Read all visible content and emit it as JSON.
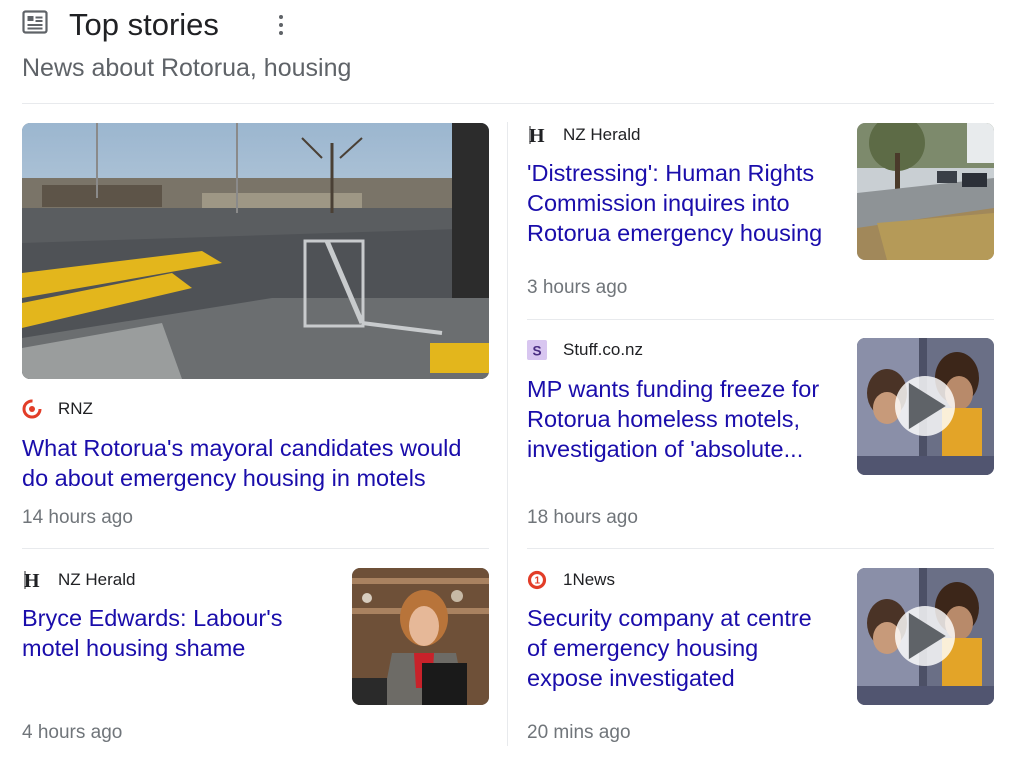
{
  "header": {
    "title": "Top stories",
    "subtitle": "News about Rotorua, housing",
    "icon": "news-icon",
    "menu_icon": "more-vert-icon"
  },
  "colors": {
    "link": "#1a0dab",
    "meta": "#70757a",
    "divider": "#e8eaed"
  },
  "stories": [
    {
      "source": "RNZ",
      "source_icon": "rnz-logo-icon",
      "headline": "What Rotorua's mayoral candidates would do about emergency housing in motels",
      "time": "14 hours ago",
      "thumbnail": "street-shopping-trolley-image",
      "video": false
    },
    {
      "source": "NZ Herald",
      "source_icon": "nz-herald-logo-icon",
      "headline": "'Distressing': Human Rights Commission inquires into Rotorua emergency housing",
      "time": "3 hours ago",
      "thumbnail": "tree-lined-street-image",
      "video": false
    },
    {
      "source": "Stuff.co.nz",
      "source_icon": "stuff-logo-icon",
      "headline": "MP wants funding freeze for Rotorua homeless motels, investigation of 'absolute...",
      "time": "18 hours ago",
      "thumbnail": "children-at-window-image",
      "video": true
    },
    {
      "source": "NZ Herald",
      "source_icon": "nz-herald-logo-icon",
      "headline": "Bryce Edwards: Labour's motel housing shame",
      "time": "4 hours ago",
      "thumbnail": "politician-speaking-image",
      "video": false
    },
    {
      "source": "1News",
      "source_icon": "1news-logo-icon",
      "headline": "Security company at centre of emergency housing expose investigated",
      "time": "20 mins ago",
      "thumbnail": "children-at-window-image",
      "video": true
    }
  ]
}
